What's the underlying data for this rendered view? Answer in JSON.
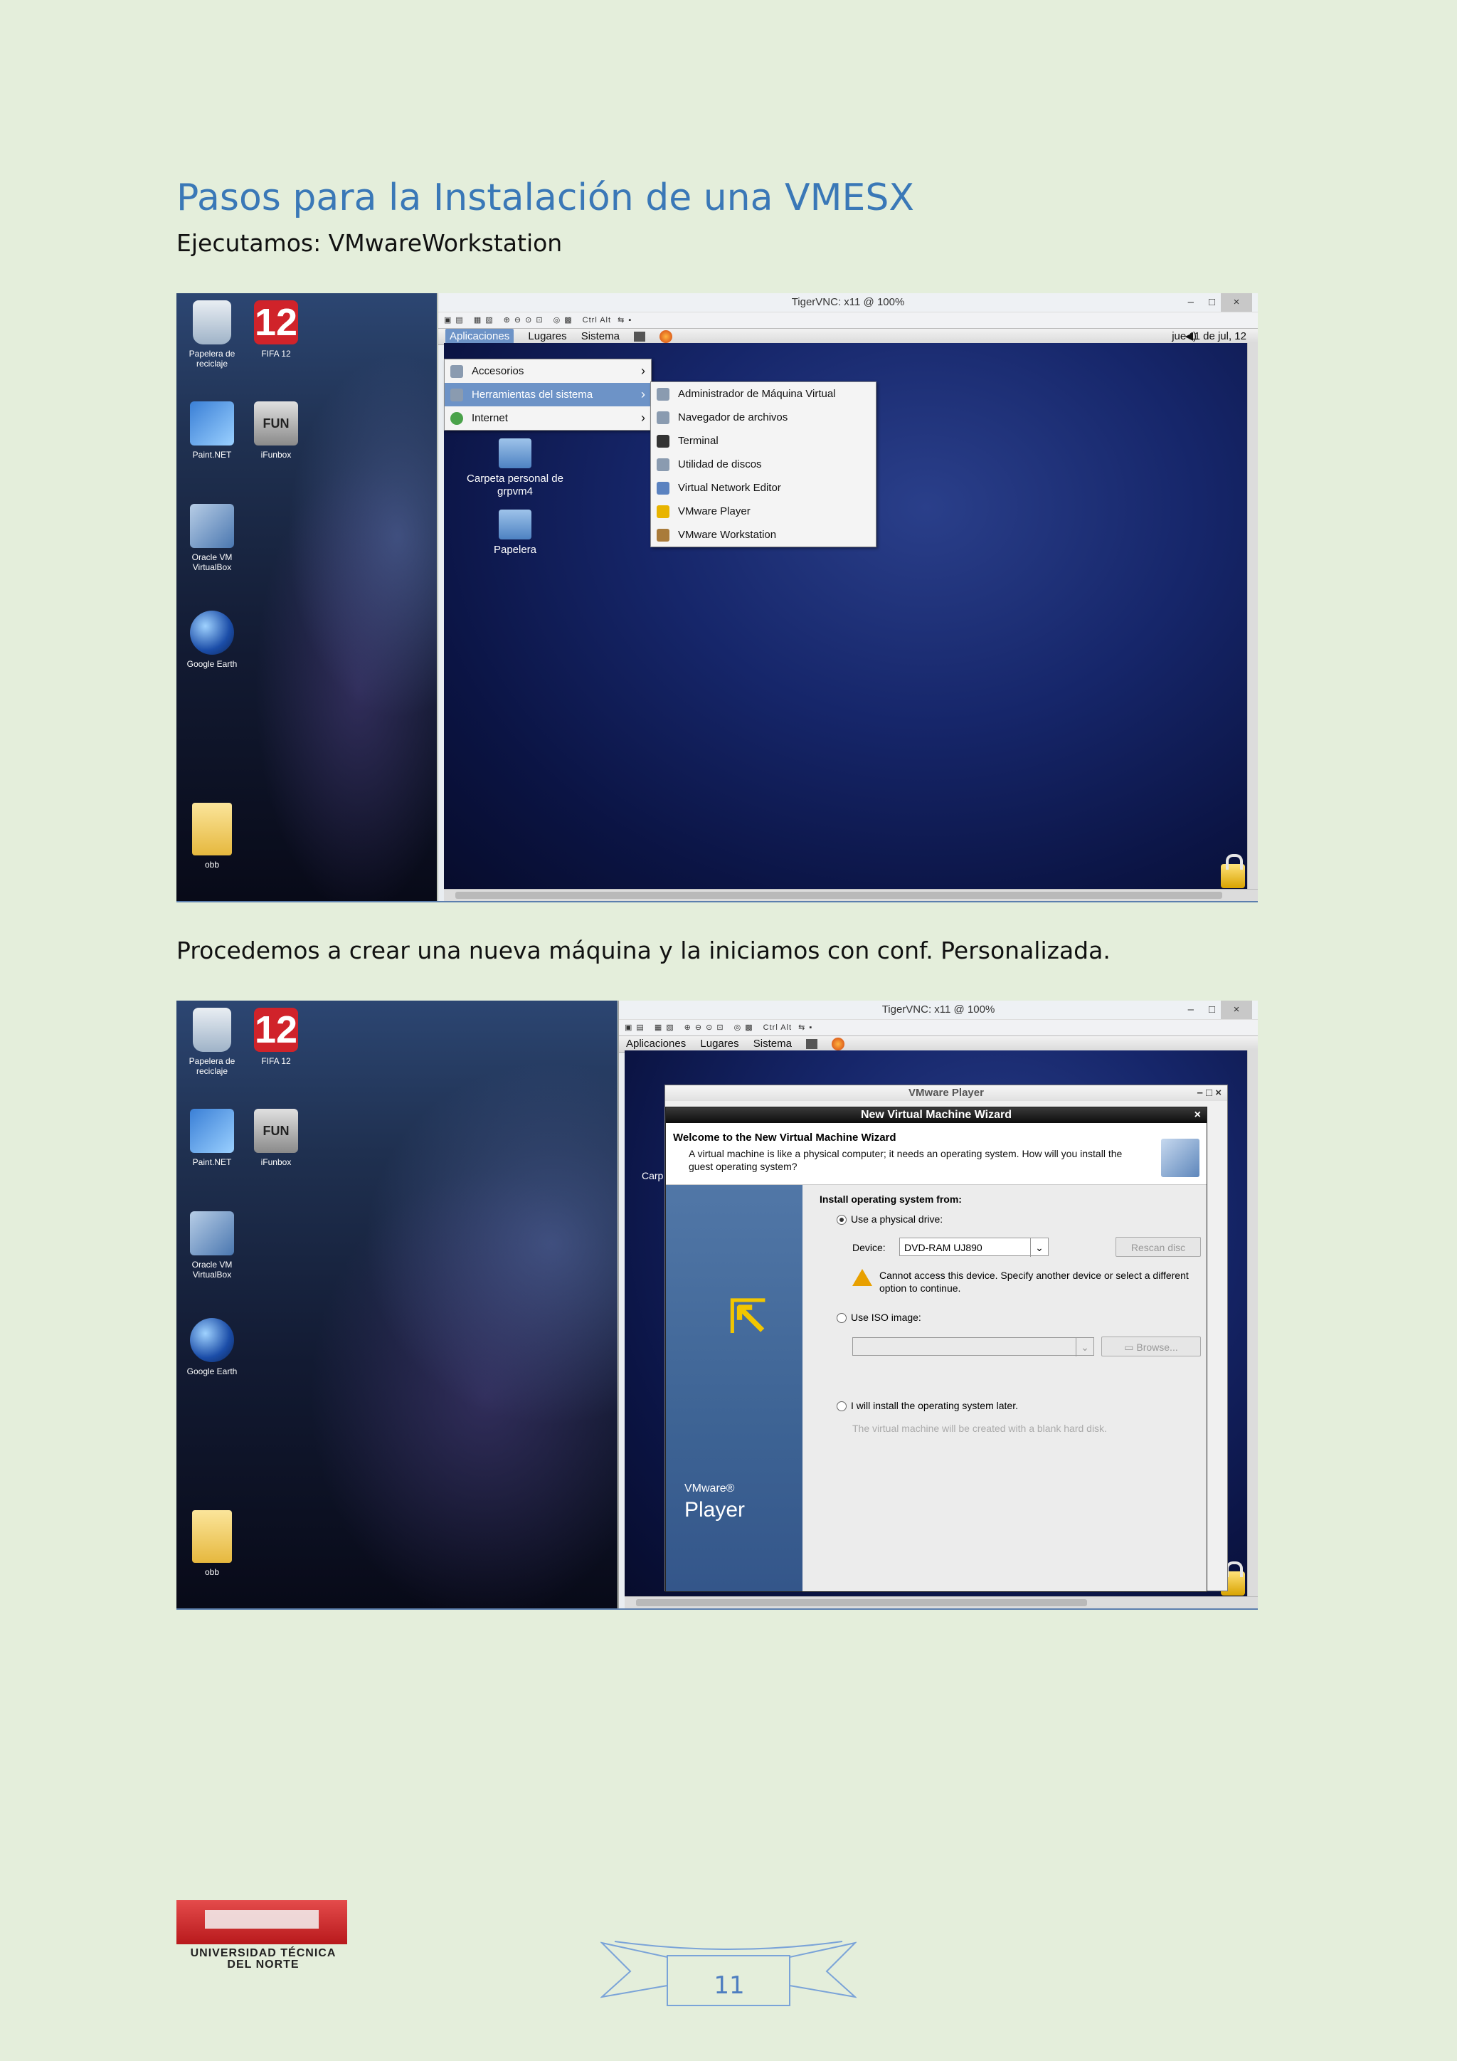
{
  "document": {
    "title": "Pasos para la Instalación de una  VMESX",
    "subtitle": "Ejecutamos: VMwareWorkstation",
    "paragraph2": "Procedemos a crear una nueva máquina y la iniciamos con conf. Personalizada.",
    "page_number": "11"
  },
  "footer_logo": {
    "line1": "UNIVERSIDAD TÉCNICA",
    "line2": "DEL NORTE"
  },
  "host_desktop_icons": {
    "recycle": "Papelera de reciclaje",
    "fifa": "FIFA 12",
    "fifa_badge": "12",
    "paint": "Paint.NET",
    "ifunbox": "iFunbox",
    "ifun_badge": "FUN",
    "virtualbox": "Oracle VM VirtualBox",
    "earth": "Google Earth",
    "obb": "obb"
  },
  "vnc": {
    "title": "TigerVNC: x11 @ 100%",
    "minimize": "–",
    "maximize": "□",
    "close": "×",
    "toolbar_text": "Ctrl Alt"
  },
  "gnome": {
    "menu_aplicaciones": "Aplicaciones",
    "menu_lugares": "Lugares",
    "menu_sistema": "Sistema",
    "clock": "jue 11 de jul, 12"
  },
  "apps_menu": {
    "items": [
      "Accesorios",
      "Herramientas del sistema",
      "Internet"
    ]
  },
  "tools_menu": {
    "items": [
      "Administrador de Máquina Virtual",
      "Navegador de archivos",
      "Terminal",
      "Utilidad de discos",
      "Virtual Network Editor",
      "VMware Player",
      "VMware Workstation"
    ]
  },
  "guest_desktop": {
    "home": "Carpeta personal de grpvm4",
    "trash": "Papelera",
    "partial_label": "Carp"
  },
  "vmware_player": {
    "window_title": "VMware Player",
    "wizard_title": "New Virtual Machine Wizard",
    "heading": "Welcome to the New Virtual Machine Wizard",
    "description": "A virtual machine is like a physical computer; it needs an operating system. How will you install the guest operating system?",
    "install_from": "Install operating system from:",
    "option_physical": "Use a physical drive:",
    "device_label": "Device:",
    "device_value": "DVD-RAM UJ890",
    "rescan": "Rescan disc",
    "warning": "Cannot access this device. Specify another device or select a different option to continue.",
    "option_iso": "Use ISO image:",
    "browse": "Browse...",
    "option_later": "I will install the operating system later.",
    "later_note": "The virtual machine will be created with a blank hard disk.",
    "brand_small": "VMware®",
    "brand_big": "Player"
  }
}
